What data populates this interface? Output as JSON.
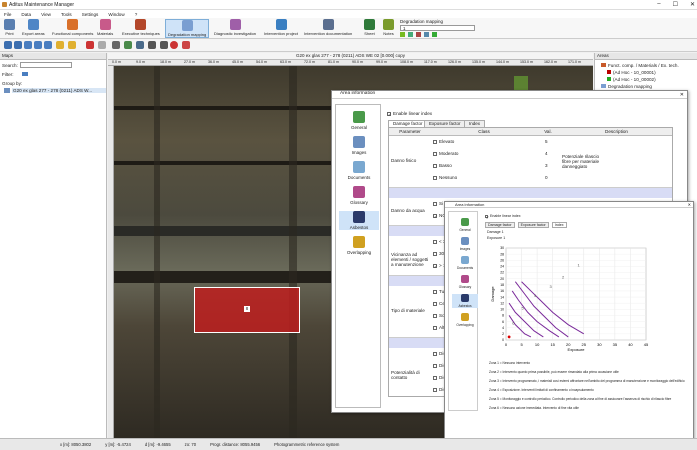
{
  "app": {
    "title": "Aditus Maintenance Manager"
  },
  "menu": [
    "File",
    "Data",
    "View",
    "Tools",
    "Settings",
    "Window",
    "?"
  ],
  "ribbon": {
    "buttons": [
      {
        "label": "Print",
        "color": "#5a7fb0"
      },
      {
        "label": "Export areas",
        "color": "#4f86c6"
      },
      {
        "label": "Functional components",
        "color": "#d9702a"
      },
      {
        "label": "Materials",
        "color": "#c85a8a"
      },
      {
        "label": "Executive techniques",
        "color": "#b3472a"
      },
      {
        "label": "Degradation mapping",
        "color": "#7a9ed1"
      },
      {
        "label": "Diagnostic investigation",
        "color": "#9f5fa8"
      },
      {
        "label": "Intervention project",
        "color": "#3a7fc1"
      },
      {
        "label": "Intervention documentation",
        "color": "#5b6f8f"
      },
      {
        "label": "Sheet",
        "color": "#2f7a3a"
      },
      {
        "label": "Notes",
        "color": "#7a9b2c"
      }
    ],
    "degradation_mapping_label": "Degradation mapping",
    "degradation_value": "1"
  },
  "left": {
    "title": "Maps",
    "search_label": "Search:",
    "filter_label": "Filter:",
    "group_label": "Group by:",
    "tree_item": "G20 ex glas 277 - 278 (0211) ADS W..."
  },
  "viewer": {
    "title": "G20 ex glas 277 - 278 (0211) ADS WE 02 [0.000] copy",
    "ruler": [
      "0.0 m",
      "9.0 m",
      "18.0 m",
      "27.0 m",
      "36.0 m",
      "45.0 m",
      "54.0 m",
      "63.0 m",
      "72.0 m",
      "81.0 m",
      "90.0 m",
      "99.0 m",
      "108.0 m",
      "117.0 m",
      "126.0 m",
      "135.0 m",
      "144.0 m",
      "153.0 m",
      "162.0 m",
      "171.0 m"
    ],
    "area_label": "8"
  },
  "right": {
    "title": "Areas",
    "items": [
      "Funct. comp. / Materials / Ex. tech.",
      "(Ad Hoc - 10_00001)",
      "(Ad Hoc - 10_00002)",
      "Degradation mapping"
    ]
  },
  "status": {
    "x": "x [m]: 8050.3802",
    "y": "y [m]: -5.4724",
    "dx": "d [m]: -9.4655",
    "zoom": "zo: 70",
    "prog": "Progr. distance: 8055.9456",
    "ref": "Photogrammetric reference system"
  },
  "dialog1": {
    "title": "Area information",
    "enable": "Enable linear index",
    "side": [
      "General",
      "Images",
      "Documents",
      "Glossary",
      "Asbestos",
      "Overlapping"
    ],
    "tabs": [
      "Damage factor",
      "Exposure factor",
      "Index"
    ],
    "headers": [
      "Parameter",
      "Class",
      "Val.",
      "Description"
    ],
    "rows": [
      {
        "param": "Danno fisico",
        "classes": [
          "Elevato",
          "Moderato",
          "Basso",
          "Nessuno"
        ],
        "vals": [
          "5",
          "4",
          "3",
          "0"
        ],
        "desc": "Potenziale rilascio fibre per materiale danneggiato"
      },
      {
        "param": "Danno da acqua",
        "classes": [
          "Si",
          "NO"
        ],
        "vals": [
          "3",
          ""
        ],
        "desc": "Potenziale"
      },
      {
        "param": "Vicinanza ad elementi / soggetti a manutenzione",
        "classes": [
          "< 30",
          "30 -",
          "> 15"
        ],
        "vals": [
          "",
          "",
          ""
        ],
        "desc": ""
      },
      {
        "param": "Tipo di materiale",
        "classes": [
          "Tubi",
          "Cem",
          "Soff",
          "Altro"
        ],
        "vals": [
          "",
          "",
          "",
          ""
        ],
        "desc": ""
      },
      {
        "param": "Potenzialità di contatto",
        "classes": [
          "Dist",
          "Dist",
          "Dist",
          "Dist"
        ],
        "vals": [
          "",
          "",
          "",
          ""
        ],
        "desc": ""
      }
    ]
  },
  "dialog2": {
    "title": "Area information",
    "enable": "Enable linear index",
    "side": [
      "General",
      "Images",
      "Documents",
      "Glossary",
      "Asbestos",
      "Overlapping"
    ],
    "tabs": [
      "Damage factor",
      "Exposure factor",
      "Index"
    ],
    "damage_label": "Damage",
    "damage_val": "1",
    "exposure_label": "Exposure",
    "exposure_val": "1",
    "zones": [
      "Zona 1 = Nessuno intervento",
      "Zona 2 = Intervento quanto prima possibile, può essere rimandato alla prima occasione utile",
      "Zona 3 = Intervento programmato, i materiali così esterni affrontare nell'ambito del programma di manutenzione e monitoraggio dell'edificio",
      "Zona 4 = Esposizione. Interventi limitati di confinamento o incapsulamento",
      "Zona 5 = Monitoraggio e controllo periodico. Controllo periodico della zona al fine di assicurare l'assenza di rischio di rilascio fibre",
      "Zona 6 = Nessuno azione immediata. Intervento di fine vita utile"
    ],
    "buttons": [
      "OK",
      "Cancel",
      "Close PDF",
      "Print"
    ]
  },
  "dialog1_buttons": [
    "OK",
    "Cancel",
    "Close PDF"
  ],
  "chart_data": {
    "type": "line",
    "xlabel": "Exposure",
    "ylabel": "Damage",
    "xlim": [
      0,
      45
    ],
    "ylim": [
      0,
      30
    ],
    "xticks": [
      0,
      5,
      10,
      15,
      20,
      25,
      30,
      35,
      40,
      45
    ],
    "yticks": [
      0,
      2,
      4,
      6,
      8,
      10,
      12,
      14,
      16,
      18,
      20,
      22,
      24,
      26,
      28,
      30
    ],
    "zone_labels": [
      "1",
      "2",
      "3",
      "4",
      "5",
      "6"
    ],
    "series": [
      {
        "values": [
          [
            5,
            19
          ],
          [
            8,
            16
          ],
          [
            11,
            13
          ],
          [
            15,
            9
          ],
          [
            20,
            5
          ],
          [
            25,
            2
          ]
        ]
      },
      {
        "values": [
          [
            3,
            19
          ],
          [
            6,
            15
          ],
          [
            9,
            11
          ],
          [
            12,
            8
          ],
          [
            16,
            4
          ],
          [
            20,
            1
          ]
        ]
      },
      {
        "values": [
          [
            2,
            16
          ],
          [
            4,
            13
          ],
          [
            7,
            9
          ],
          [
            10,
            6
          ],
          [
            14,
            3
          ],
          [
            17,
            1
          ]
        ]
      },
      {
        "values": [
          [
            1,
            12
          ],
          [
            3,
            9
          ],
          [
            6,
            6
          ],
          [
            9,
            3
          ],
          [
            12,
            1
          ]
        ]
      },
      {
        "values": [
          [
            1,
            8
          ],
          [
            3,
            5
          ],
          [
            6,
            2
          ],
          [
            8,
            1
          ]
        ]
      }
    ],
    "point": [
      1,
      1
    ]
  }
}
